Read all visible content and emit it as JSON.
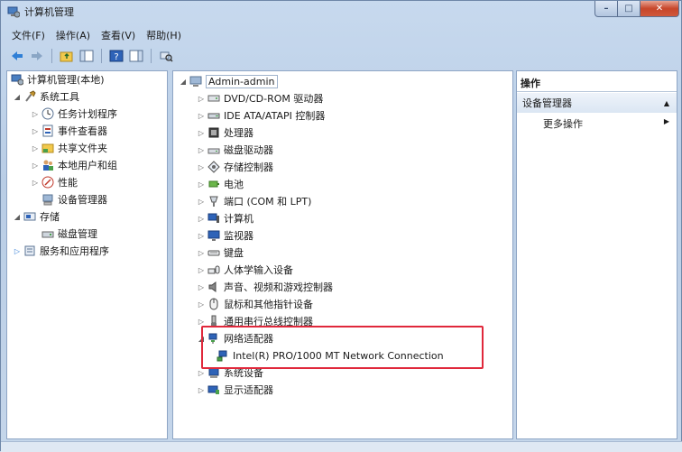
{
  "window": {
    "title": "计算机管理",
    "min_glyph": "–",
    "max_glyph": "□",
    "close_glyph": "✕"
  },
  "menu": [
    "文件(F)",
    "操作(A)",
    "查看(V)",
    "帮助(H)"
  ],
  "left_tree": {
    "root": "计算机管理(本地)",
    "system_tools": "系统工具",
    "task_scheduler": "任务计划程序",
    "event_viewer": "事件查看器",
    "shared_folders": "共享文件夹",
    "local_users": "本地用户和组",
    "performance": "性能",
    "device_manager": "设备管理器",
    "storage": "存储",
    "disk_management": "磁盘管理",
    "services": "服务和应用程序"
  },
  "device_tree": {
    "root": "Admin-admin",
    "items": [
      "DVD/CD-ROM 驱动器",
      "IDE ATA/ATAPI 控制器",
      "处理器",
      "磁盘驱动器",
      "存储控制器",
      "电池",
      "端口 (COM 和 LPT)",
      "计算机",
      "监视器",
      "键盘",
      "人体学输入设备",
      "声音、视频和游戏控制器",
      "鼠标和其他指针设备",
      "通用串行总线控制器",
      "网络适配器",
      "Intel(R) PRO/1000 MT Network Connection",
      "系统设备",
      "显示适配器"
    ]
  },
  "actions": {
    "header": "操作",
    "group": "设备管理器",
    "more": "更多操作"
  },
  "colors": {
    "highlight": "#e0283b"
  }
}
